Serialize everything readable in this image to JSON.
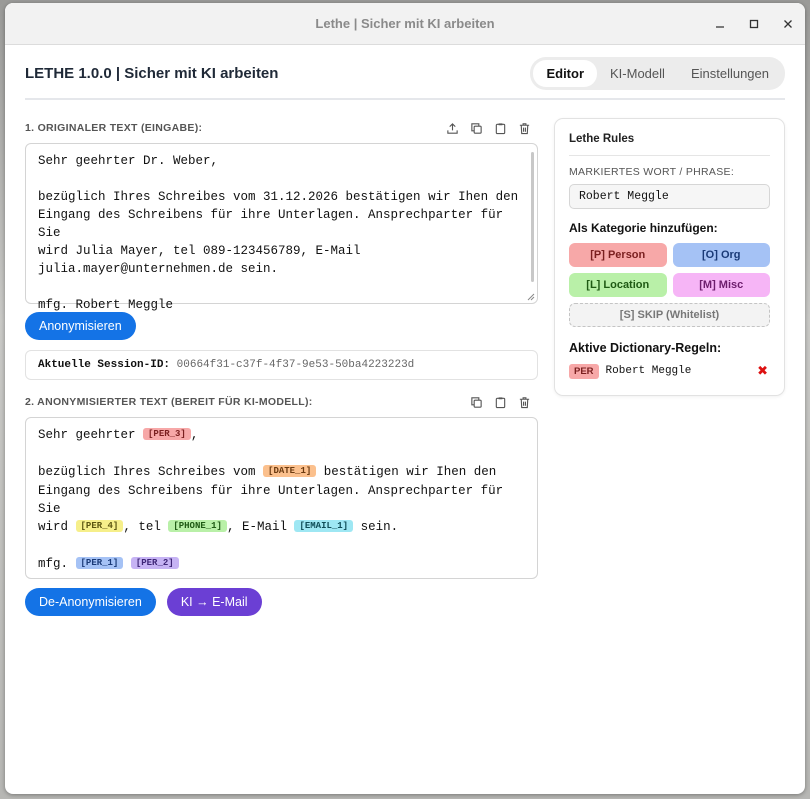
{
  "window": {
    "title": "Lethe | Sicher mit KI arbeiten"
  },
  "app": {
    "title": "LETHE 1.0.0 | Sicher mit KI arbeiten"
  },
  "tabs": [
    {
      "label": "Editor",
      "active": true
    },
    {
      "label": "KI-Modell",
      "active": false
    },
    {
      "label": "Einstellungen",
      "active": false
    }
  ],
  "input": {
    "label": "1. ORIGINALER TEXT (EINGABE):",
    "lines": [
      "Sehr geehrter Dr. Weber,",
      "",
      "bezüglich Ihres Schreibes vom 31.12.2026 bestätigen wir Ihen den",
      "Eingang des Schreibens für ihre Unterlagen. Ansprechparter für Sie",
      "wird Julia Mayer, tel 089-123456789, E-Mail",
      "julia.mayer@unternehmen.de sein.",
      "",
      "mfg. Robert Meggle"
    ]
  },
  "actions": {
    "anonymize": "Anonymisieren",
    "deanonymize": "De-Anonymisieren",
    "ai_email": "KI → E-Mail"
  },
  "session": {
    "label": "Aktuelle Session-ID:",
    "id": "00664f31-c37f-4f37-9e53-50ba4223223d"
  },
  "output": {
    "label": "2. ANONYMISIERTER TEXT (BEREIT FÜR KI-MODELL):",
    "l1_pre": "Sehr geehrter ",
    "l1_tok": "[PER_3]",
    "l1_post": ",",
    "l2_pre": "bezüglich Ihres Schreibes vom ",
    "l2_tok": "[DATE_1]",
    "l2_post": " bestätigen wir Ihen den",
    "l3": "Eingang des Schreibens für ihre Unterlagen. Ansprechparter für Sie",
    "l4_pre": "wird ",
    "l4_tok1": "[PER_4]",
    "l4_mid1": ", tel ",
    "l4_tok2": "[PHONE_1]",
    "l4_mid2": ", E-Mail ",
    "l4_tok3": "[EMAIL_1]",
    "l4_post": " sein.",
    "l5_pre": "mfg. ",
    "l5_tok1": "[PER_1]",
    "l5_tok2": "[PER_2]"
  },
  "rules": {
    "title": "Lethe Rules",
    "marked_label": "MARKIERTES WORT / PHRASE:",
    "marked_value": "Robert Meggle",
    "category_heading": "Als Kategorie hinzufügen:",
    "categories": {
      "person": "[P] Person",
      "org": "[O] Org",
      "location": "[L] Location",
      "misc": "[M] Misc",
      "skip": "[S] SKIP (Whitelist)"
    },
    "dict_heading": "Aktive Dictionary-Regeln:",
    "entries": [
      {
        "tag": "PER",
        "text": "Robert Meggle",
        "remove": "✖"
      }
    ]
  },
  "colors": {
    "primary_button": "#1473e6",
    "ai_button": "#6b3fd4",
    "person": "#f7a8a8",
    "org": "#a5c2f5",
    "location": "#b9f0a8",
    "misc": "#f6b5f6"
  },
  "icons": {
    "window_controls": [
      "minimize-icon",
      "maximize-icon",
      "close-icon"
    ],
    "input_toolbar": [
      "upload-icon",
      "copy-icon",
      "paste-icon",
      "trash-icon"
    ],
    "output_toolbar": [
      "copy-icon",
      "paste-icon",
      "trash-icon"
    ]
  }
}
